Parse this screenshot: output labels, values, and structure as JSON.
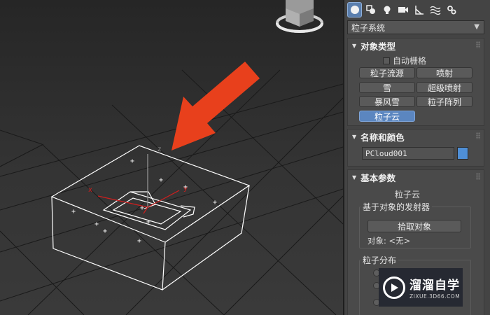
{
  "command_panel": {
    "tabs": [
      {
        "icon": "create-circle-icon",
        "active": true
      },
      {
        "icon": "shapes-icon"
      },
      {
        "icon": "light-bulb-icon"
      },
      {
        "icon": "camera-icon"
      },
      {
        "icon": "helper-ruler-icon"
      },
      {
        "icon": "space-warp-icon"
      },
      {
        "icon": "systems-gears-icon"
      }
    ],
    "category_dropdown": "粒子系统",
    "object_type": {
      "title": "对象类型",
      "auto_grid": "自动栅格",
      "buttons": [
        "粒子流源",
        "喷射",
        "雪",
        "超级喷射",
        "暴风雪",
        "粒子阵列",
        "粒子云"
      ],
      "selected": "粒子云"
    },
    "name_color": {
      "title": "名称和颜色",
      "name_value": "PCloud001",
      "color": "#4f8fd6"
    },
    "basic_params": {
      "title": "基本参数",
      "subtitle": "粒子云",
      "emitter_group": "基于对象的发射器",
      "pick_object": "拾取对象",
      "object_label": "对象: <无>",
      "distribution_group": "粒子分布"
    }
  },
  "watermark": {
    "title": "溜溜自学",
    "subtitle": "ZIXUE.3D66.COM"
  },
  "colors": {
    "accent_selected": "#5b86c0",
    "arrow": "#e8401c"
  }
}
